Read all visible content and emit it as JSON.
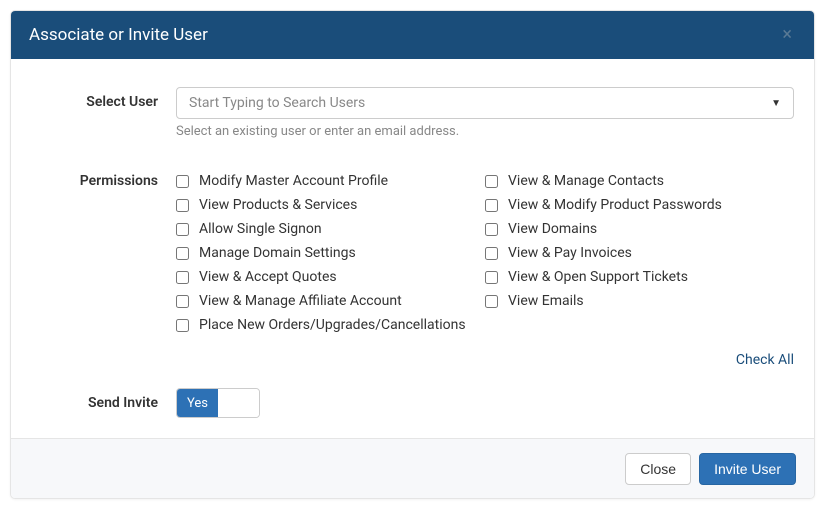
{
  "modal": {
    "title": "Associate or Invite User"
  },
  "selectUser": {
    "label": "Select User",
    "placeholder": "Start Typing to Search Users",
    "hint": "Select an existing user or enter an email address."
  },
  "permissions": {
    "label": "Permissions",
    "left": [
      "Modify Master Account Profile",
      "View Products & Services",
      "Allow Single Signon",
      "Manage Domain Settings",
      "View & Accept Quotes",
      "View & Manage Affiliate Account",
      "Place New Orders/Upgrades/Cancellations"
    ],
    "right": [
      "View & Manage Contacts",
      "View & Modify Product Passwords",
      "View Domains",
      "View & Pay Invoices",
      "View & Open Support Tickets",
      "View Emails"
    ],
    "checkAll": "Check All"
  },
  "sendInvite": {
    "label": "Send Invite",
    "yes": "Yes"
  },
  "footer": {
    "close": "Close",
    "invite": "Invite User"
  }
}
